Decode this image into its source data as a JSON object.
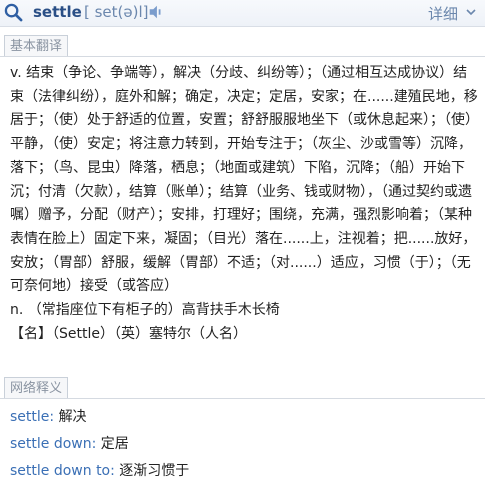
{
  "header": {
    "logo_icon": "youdao-dict-icon",
    "word": "settle",
    "phonetic": "[ set(ə)l]",
    "speaker_icon": "speaker-icon",
    "detail_label": "详细",
    "chevron_icon": "chevron-down-icon"
  },
  "basic": {
    "title": "基本翻译",
    "paragraphs": [
      "v. 结束（争论、争端等），解决（分歧、纠纷等）；（通过相互达成协议）结束（法律纠纷），庭外和解；确定，决定；定居，安家；在......建殖民地，移居于；（使）处于舒适的位置，安置；舒舒服服地坐下（或休息起来）；（使）平静，（使）安定；将注意力转到，开始专注于；（灰尘、沙或雪等）沉降，落下；（鸟、昆虫）降落，栖息；（地面或建筑）下陷，沉降；（船）开始下沉；付清（欠款），结算（账单）；结算（业务、钱或财物），（通过契约或遗嘱）赠予，分配（财产）；安排，打理好；围绕，充满，强烈影响着；（某种表情在脸上）固定下来，凝固；（目光）落在......上，注视着；把......放好，安放；（胃部）舒服，缓解（胃部）不适；（对......）适应，习惯（于）；（无可奈何地）接受（或答应）",
      "n. （常指座位下有柜子的）高背扶手木长椅",
      "【名】（Settle）（英）塞特尔（人名）"
    ]
  },
  "web": {
    "title": "网络释义",
    "items": [
      {
        "term": "settle",
        "meaning": "解决"
      },
      {
        "term": "settle down",
        "meaning": "定居"
      },
      {
        "term": "settle down to",
        "meaning": "逐渐习惯于"
      }
    ]
  },
  "colors": {
    "accent": "#2a4f86",
    "link": "#3a6fb5",
    "muted": "#8a94a2"
  }
}
